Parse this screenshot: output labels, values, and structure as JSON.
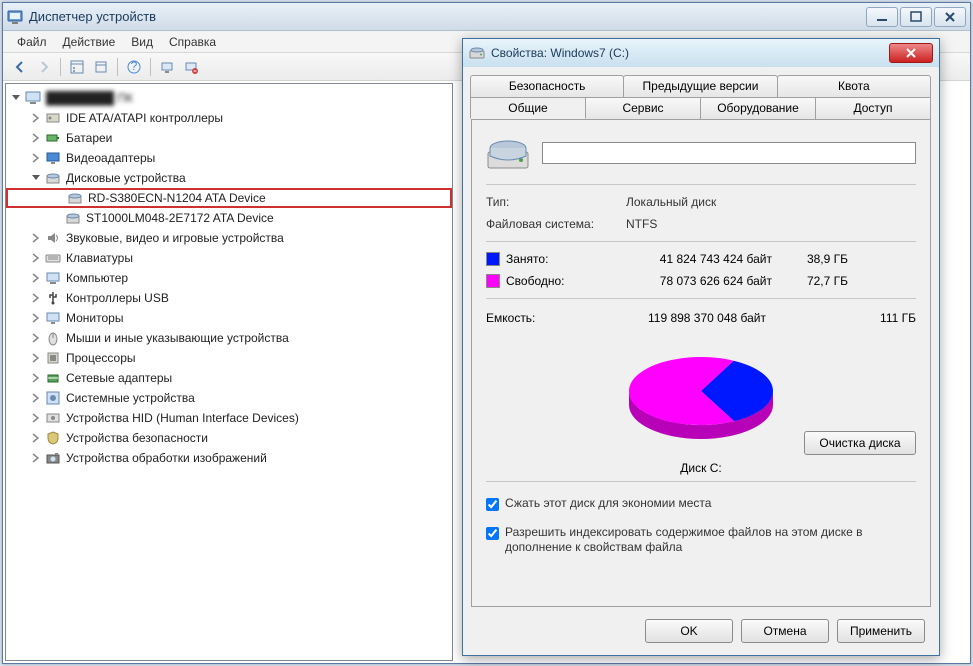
{
  "devmgr": {
    "title": "Диспетчер устройств",
    "menu": {
      "file": "Файл",
      "action": "Действие",
      "view": "Вид",
      "help": "Справка"
    },
    "root": "████████ ПК",
    "tree": [
      {
        "label": "IDE ATA/ATAPI контроллеры",
        "icon": "ide"
      },
      {
        "label": "Батареи",
        "icon": "battery"
      },
      {
        "label": "Видеоадаптеры",
        "icon": "display"
      },
      {
        "label": "Дисковые устройства",
        "icon": "disk",
        "expanded": true,
        "children": [
          {
            "label": "RD-S380ECN-N1204 ATA Device",
            "highlight": true
          },
          {
            "label": "ST1000LM048-2E7172 ATA Device"
          }
        ]
      },
      {
        "label": "Звуковые, видео и игровые устройства",
        "icon": "sound"
      },
      {
        "label": "Клавиатуры",
        "icon": "keyboard"
      },
      {
        "label": "Компьютер",
        "icon": "computer"
      },
      {
        "label": "Контроллеры USB",
        "icon": "usb"
      },
      {
        "label": "Мониторы",
        "icon": "monitor"
      },
      {
        "label": "Мыши и иные указывающие устройства",
        "icon": "mouse"
      },
      {
        "label": "Процессоры",
        "icon": "cpu"
      },
      {
        "label": "Сетевые адаптеры",
        "icon": "network"
      },
      {
        "label": "Системные устройства",
        "icon": "system"
      },
      {
        "label": "Устройства HID (Human Interface Devices)",
        "icon": "hid"
      },
      {
        "label": "Устройства безопасности",
        "icon": "security"
      },
      {
        "label": "Устройства обработки изображений",
        "icon": "imaging"
      }
    ]
  },
  "props": {
    "title": "Свойства: Windows7 (C:)",
    "tabs_row1": [
      "Безопасность",
      "Предыдущие версии",
      "Квота"
    ],
    "tabs_row2": [
      "Общие",
      "Сервис",
      "Оборудование",
      "Доступ"
    ],
    "active_tab": "Общие",
    "name_value": "",
    "type_label": "Тип:",
    "type_value": "Локальный диск",
    "fs_label": "Файловая система:",
    "fs_value": "NTFS",
    "used": {
      "label": "Занято:",
      "bytes": "41 824 743 424 байт",
      "human": "38,9 ГБ",
      "color": "#0018ff"
    },
    "free": {
      "label": "Свободно:",
      "bytes": "78 073 626 624 байт",
      "human": "72,7 ГБ",
      "color": "#ff00ff"
    },
    "capacity": {
      "label": "Емкость:",
      "bytes": "119 898 370 048 байт",
      "human": "111 ГБ"
    },
    "pie_caption": "Диск C:",
    "cleanup_btn": "Очистка диска",
    "compress_label": "Сжать этот диск для экономии места",
    "index_label": "Разрешить индексировать содержимое файлов на этом диске в дополнение к свойствам файла",
    "compress_checked": true,
    "index_checked": true,
    "buttons": {
      "ok": "OK",
      "cancel": "Отмена",
      "apply": "Применить"
    }
  },
  "chart_data": {
    "type": "pie",
    "title": "Диск C:",
    "series": [
      {
        "name": "Занято",
        "value": 41824743424,
        "human": "38,9 ГБ",
        "color": "#0018ff"
      },
      {
        "name": "Свободно",
        "value": 78073626624,
        "human": "72,7 ГБ",
        "color": "#ff00ff"
      }
    ],
    "total": {
      "label": "Емкость",
      "value": 119898370048,
      "human": "111 ГБ"
    }
  }
}
